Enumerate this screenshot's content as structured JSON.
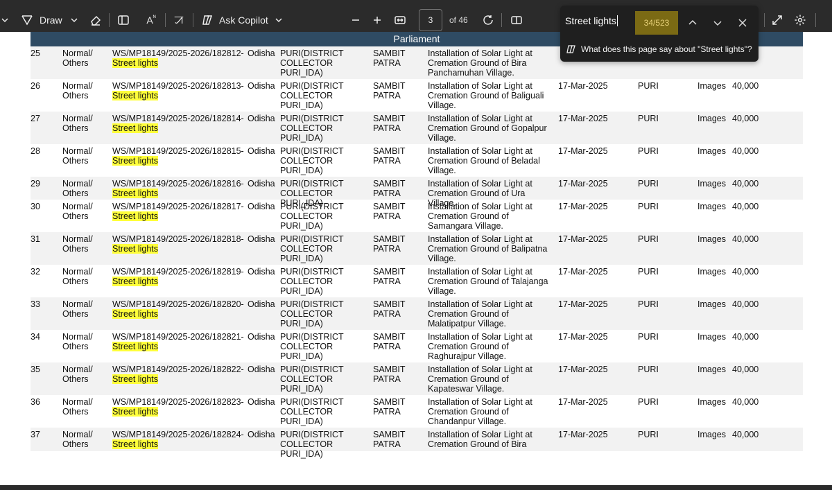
{
  "toolbar": {
    "draw_label": "Draw",
    "ask_copilot_label": "Ask Copilot",
    "current_page": "3",
    "total_pages": "of 46",
    "text_icon_label": "A",
    "lang_icon_label": "ꠀ",
    "edge_label": "Ec"
  },
  "find": {
    "query": "Street lights",
    "count": "34/523",
    "copilot_suggestion": "What does this page say about \"Street lights\"?"
  },
  "document": {
    "section_header": "Parliament",
    "highlight_term": "Street lights",
    "rows": [
      {
        "no": "25",
        "type": "Normal/ Others",
        "ws": "WS/MP18149/2025-2026/182812-",
        "state": "Odisha",
        "district": "PURI(DISTRICT COLLECTOR PURI_IDA)",
        "mp": "SAMBIT PATRA",
        "work": "Installation of Solar Light at Cremation Ground of Bira Panchamuhan Village.",
        "date": "",
        "location": "",
        "images": "",
        "amount": ""
      },
      {
        "no": "26",
        "type": "Normal/ Others",
        "ws": "WS/MP18149/2025-2026/182813-",
        "state": "Odisha",
        "district": "PURI(DISTRICT COLLECTOR PURI_IDA)",
        "mp": "SAMBIT PATRA",
        "work": "Installation of Solar Light at Cremation Ground of Baliguali Village.",
        "date": "17-Mar-2025",
        "location": "PURI",
        "images": "Images",
        "amount": "40,000"
      },
      {
        "no": "27",
        "type": "Normal/ Others",
        "ws": "WS/MP18149/2025-2026/182814-",
        "state": "Odisha",
        "district": "PURI(DISTRICT COLLECTOR PURI_IDA)",
        "mp": "SAMBIT PATRA",
        "work": "Installation of Solar Light at Cremation Ground of Gopalpur Village.",
        "date": "17-Mar-2025",
        "location": "PURI",
        "images": "Images",
        "amount": "40,000"
      },
      {
        "no": "28",
        "type": "Normal/ Others",
        "ws": "WS/MP18149/2025-2026/182815-",
        "state": "Odisha",
        "district": "PURI(DISTRICT COLLECTOR PURI_IDA)",
        "mp": "SAMBIT PATRA",
        "work": "Installation of Solar Light at Cremation Ground of Beladal Village.",
        "date": "17-Mar-2025",
        "location": "PURI",
        "images": "Images",
        "amount": "40,000"
      },
      {
        "no": "29",
        "type": "Normal/ Others",
        "ws": "WS/MP18149/2025-2026/182816-",
        "state": "Odisha",
        "district": "PURI(DISTRICT COLLECTOR PURI_IDA)",
        "mp": "SAMBIT PATRA",
        "work": "Installation of Solar Light at Cremation Ground of Ura Village.",
        "date": "17-Mar-2025",
        "location": "PURI",
        "images": "Images",
        "amount": "40,000"
      },
      {
        "no": "30",
        "type": "Normal/ Others",
        "ws": "WS/MP18149/2025-2026/182817-",
        "state": "Odisha",
        "district": "PURI(DISTRICT COLLECTOR PURI_IDA)",
        "mp": "SAMBIT PATRA",
        "work": "Installation of Solar Light at Cremation Ground of Samangara Village.",
        "date": "17-Mar-2025",
        "location": "PURI",
        "images": "Images",
        "amount": "40,000"
      },
      {
        "no": "31",
        "type": "Normal/ Others",
        "ws": "WS/MP18149/2025-2026/182818-",
        "state": "Odisha",
        "district": "PURI(DISTRICT COLLECTOR PURI_IDA)",
        "mp": "SAMBIT PATRA",
        "work": "Installation of Solar Light at Cremation Ground of Balipatna Village.",
        "date": "17-Mar-2025",
        "location": "PURI",
        "images": "Images",
        "amount": "40,000"
      },
      {
        "no": "32",
        "type": "Normal/ Others",
        "ws": "WS/MP18149/2025-2026/182819-",
        "state": "Odisha",
        "district": "PURI(DISTRICT COLLECTOR PURI_IDA)",
        "mp": "SAMBIT PATRA",
        "work": "Installation of Solar Light at Cremation Ground of Talajanga Village.",
        "date": "17-Mar-2025",
        "location": "PURI",
        "images": "Images",
        "amount": "40,000"
      },
      {
        "no": "33",
        "type": "Normal/ Others",
        "ws": "WS/MP18149/2025-2026/182820-",
        "state": "Odisha",
        "district": "PURI(DISTRICT COLLECTOR PURI_IDA)",
        "mp": "SAMBIT PATRA",
        "work": "Installation of Solar Light at Cremation Ground of Malatipatpur Village.",
        "date": "17-Mar-2025",
        "location": "PURI",
        "images": "Images",
        "amount": "40,000"
      },
      {
        "no": "34",
        "type": "Normal/ Others",
        "ws": "WS/MP18149/2025-2026/182821-",
        "state": "Odisha",
        "district": "PURI(DISTRICT COLLECTOR PURI_IDA)",
        "mp": "SAMBIT PATRA",
        "work": "Installation of Solar Light at Cremation Ground of Raghurajpur Village.",
        "date": "17-Mar-2025",
        "location": "PURI",
        "images": "Images",
        "amount": "40,000"
      },
      {
        "no": "35",
        "type": "Normal/ Others",
        "ws": "WS/MP18149/2025-2026/182822-",
        "state": "Odisha",
        "district": "PURI(DISTRICT COLLECTOR PURI_IDA)",
        "mp": "SAMBIT PATRA",
        "work": "Installation of Solar Light at Cremation Ground of Kapateswar Village.",
        "date": "17-Mar-2025",
        "location": "PURI",
        "images": "Images",
        "amount": "40,000"
      },
      {
        "no": "36",
        "type": "Normal/ Others",
        "ws": "WS/MP18149/2025-2026/182823-",
        "state": "Odisha",
        "district": "PURI(DISTRICT COLLECTOR PURI_IDA)",
        "mp": "SAMBIT PATRA",
        "work": "Installation of Solar Light at Cremation Ground of Chandanpur Village.",
        "date": "17-Mar-2025",
        "location": "PURI",
        "images": "Images",
        "amount": "40,000"
      },
      {
        "no": "37",
        "type": "Normal/ Others",
        "ws": "WS/MP18149/2025-2026/182824-",
        "state": "Odisha",
        "district": "PURI(DISTRICT COLLECTOR PURI_IDA)",
        "mp": "SAMBIT PATRA",
        "work": "Installation of Solar Light at Cremation Ground of Bira",
        "date": "17-Mar-2025",
        "location": "PURI",
        "images": "Images",
        "amount": "40,000"
      }
    ]
  }
}
